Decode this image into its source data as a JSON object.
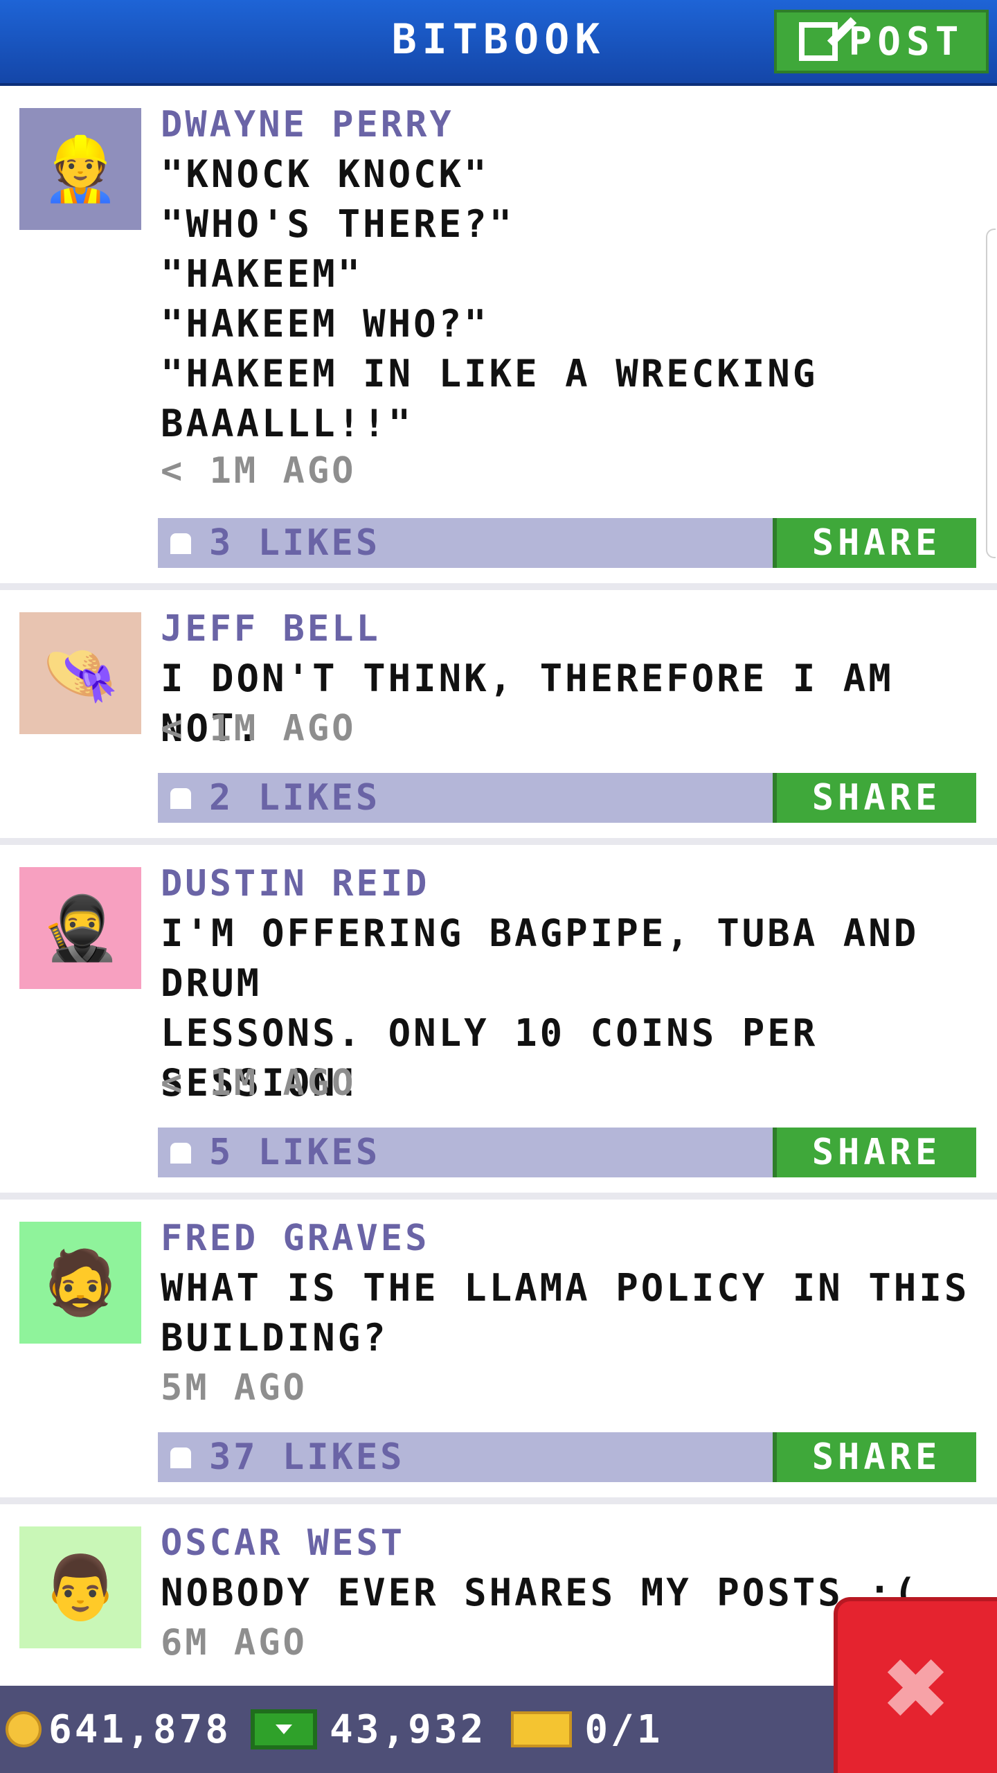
{
  "header": {
    "title": "BITBOOK",
    "post_label": "POST"
  },
  "posts": [
    {
      "author": "DWAYNE PERRY",
      "message": "\"KNOCK KNOCK\"\n\"WHO'S THERE?\"\n\"HAKEEM\"\n\"HAKEEM WHO?\"\n\"HAKEEM IN LIKE A WRECKING\nBAAALLL!!\"",
      "time": "< 1M AGO",
      "likes": "3 LIKES",
      "share_label": "SHARE",
      "avatar_bg": "#8f8fbc"
    },
    {
      "author": "JEFF BELL",
      "message": "I DON'T THINK, THEREFORE I AM NOT.",
      "time": "< 1M AGO",
      "likes": "2 LIKES",
      "share_label": "SHARE",
      "avatar_bg": "#e8c4b1"
    },
    {
      "author": "DUSTIN REID",
      "message": "I'M OFFERING BAGPIPE, TUBA AND DRUM\nLESSONS. ONLY 10 COINS PER\nSESSION!",
      "time": "< 1M AGO",
      "likes": "5 LIKES",
      "share_label": "SHARE",
      "avatar_bg": "#f7a0c0"
    },
    {
      "author": "FRED GRAVES",
      "message": "WHAT IS THE LLAMA POLICY IN THIS\nBUILDING?",
      "time": "5M AGO",
      "likes": "37 LIKES",
      "share_label": "SHARE",
      "avatar_bg": "#8ff39b"
    },
    {
      "author": "OSCAR WEST",
      "message": "NOBODY EVER SHARES MY POSTS :(",
      "time": "6M AGO",
      "avatar_bg": "#c9f7b7"
    }
  ],
  "bottom_bar": {
    "coins": "641,878",
    "bux": "43,932",
    "tickets": "0/1"
  },
  "colors": {
    "header": "#1e64d6",
    "accent_green": "#3fa83a",
    "like_bar": "#b4b6d8",
    "author": "#6a64a6",
    "bottom_bar": "#4e4f77",
    "close": "#e5232f"
  },
  "icons": {
    "post": "edit-icon",
    "like": "thumbs-up-icon",
    "coin": "coin-icon",
    "bux": "bux-icon",
    "ticket": "ticket-icon",
    "close": "close-icon"
  }
}
